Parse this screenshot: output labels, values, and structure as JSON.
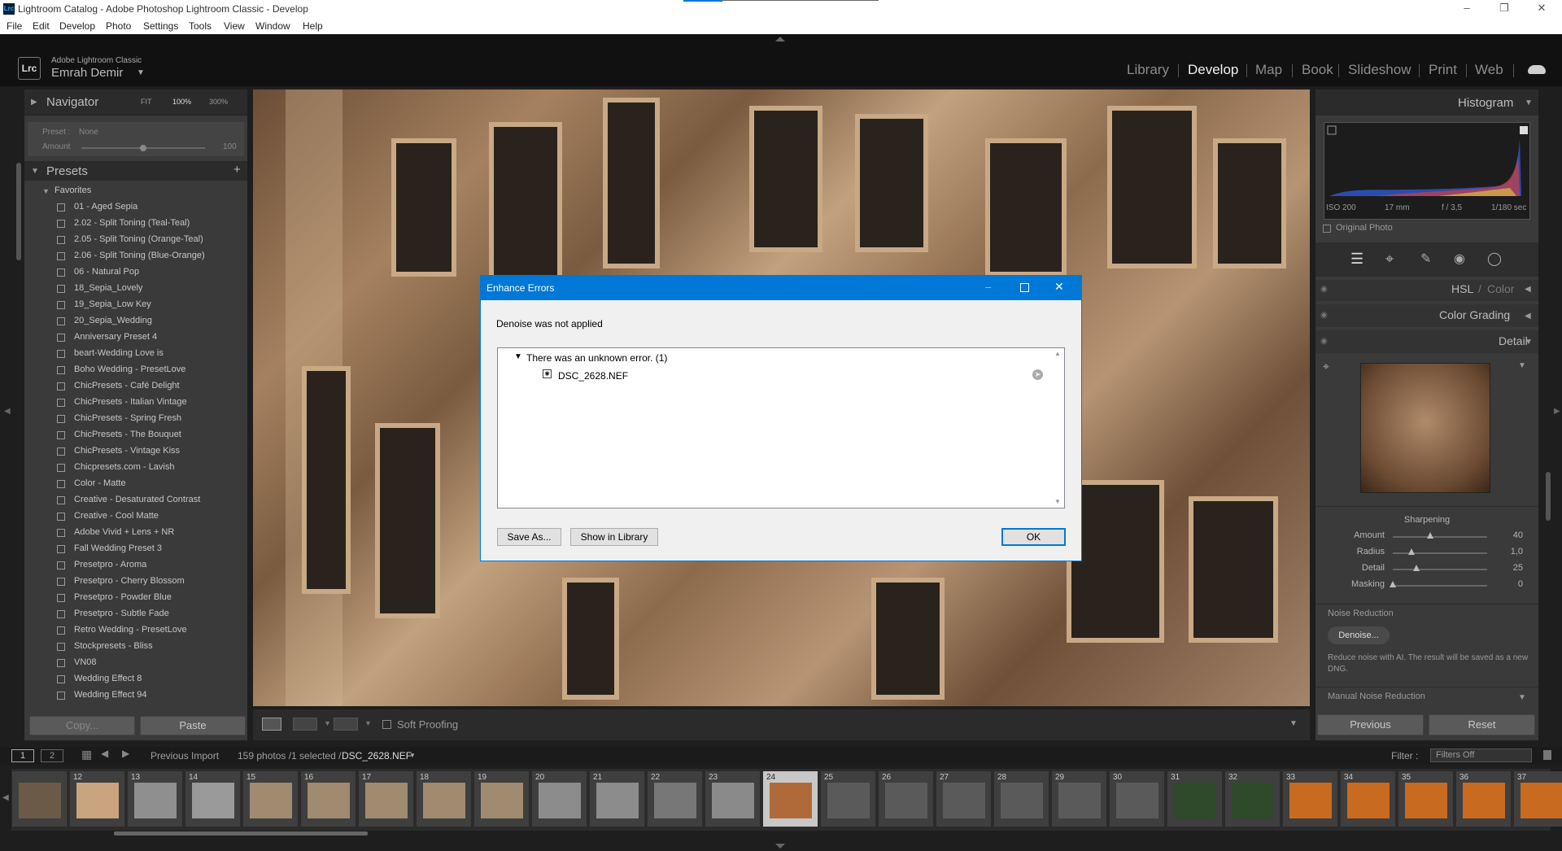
{
  "window": {
    "title": "Lightroom Catalog - Adobe Photoshop Lightroom Classic - Develop",
    "logo": "Lrc"
  },
  "menu": [
    "File",
    "Edit",
    "Develop",
    "Photo",
    "Settings",
    "Tools",
    "View",
    "Window",
    "Help"
  ],
  "identity": {
    "app": "Adobe Lightroom Classic",
    "user": "Emrah Demir"
  },
  "modules": [
    "Library",
    "Develop",
    "Map",
    "Book",
    "Slideshow",
    "Print",
    "Web"
  ],
  "active_module": "Develop",
  "navigator": {
    "title": "Navigator",
    "zoom_fit": "FIT",
    "zoom_100": "100%",
    "zoom_300": "300%"
  },
  "preset_amount": {
    "preset_label": "Preset :",
    "preset_value": "None",
    "amount_label": "Amount",
    "amount_value": "100"
  },
  "presets": {
    "title": "Presets",
    "folder": "Favorites",
    "items": [
      "01 - Aged Sepia",
      "2.02 - Split Toning (Teal-Teal)",
      "2.05 - Split Toning (Orange-Teal)",
      "2.06 - Split Toning (Blue-Orange)",
      "06 - Natural Pop",
      "18_Sepia_Lovely",
      "19_Sepia_Low Key",
      "20_Sepia_Wedding",
      "Anniversary Preset 4",
      "beart-Wedding Love is",
      "Boho Wedding - PresetLove",
      "ChicPresets - Café Delight",
      "ChicPresets - Italian Vintage",
      "ChicPresets - Spring Fresh",
      "ChicPresets - The Bouquet",
      "ChicPresets - Vintage Kiss",
      "Chicpresets.com - Lavish",
      "Color - Matte",
      "Creative - Desaturated Contrast",
      "Creative - Cool Matte",
      "Adobe Vivid + Lens + NR",
      "Fall Wedding Preset 3",
      "Presetpro - Aroma",
      "Presetpro - Cherry Blossom",
      "Presetpro - Powder Blue",
      "Presetpro - Subtle Fade",
      "Retro Wedding - PresetLove",
      "Stockpresets - Bliss",
      "VN08",
      "Wedding Effect 8",
      "Wedding Effect 94"
    ]
  },
  "left_buttons": {
    "copy": "Copy...",
    "paste": "Paste"
  },
  "toolbar": {
    "soft_proofing": "Soft Proofing"
  },
  "histogram": {
    "title": "Histogram",
    "iso": "ISO 200",
    "focal": "17 mm",
    "aperture": "f / 3,5",
    "shutter": "1/180 sec",
    "original_photo": "Original Photo"
  },
  "panels": {
    "hsl": "HSL",
    "color": "Color",
    "color_grading": "Color Grading",
    "detail": "Detail"
  },
  "sharpening": {
    "title": "Sharpening",
    "rows": [
      {
        "label": "Amount",
        "value": "40",
        "pos": 0.4
      },
      {
        "label": "Radius",
        "value": "1,0",
        "pos": 0.2
      },
      {
        "label": "Detail",
        "value": "25",
        "pos": 0.25
      },
      {
        "label": "Masking",
        "value": "0",
        "pos": 0.0
      }
    ]
  },
  "noise": {
    "title": "Noise Reduction",
    "denoise": "Denoise...",
    "desc": "Reduce noise with AI. The result will be saved as a new DNG.",
    "manual": "Manual Noise Reduction"
  },
  "right_buttons": {
    "previous": "Previous",
    "reset": "Reset"
  },
  "filmstrip_bar": {
    "screen1": "1",
    "screen2": "2",
    "source": "Previous Import",
    "count": "159 photos /1 selected /",
    "file": "DSC_2628.NEF",
    "filter_label": "Filter :",
    "filter_value": "Filters Off"
  },
  "filmstrip": [
    "",
    "12",
    "13",
    "14",
    "15",
    "16",
    "17",
    "18",
    "19",
    "20",
    "21",
    "22",
    "23",
    "24",
    "25",
    "26",
    "27",
    "28",
    "29",
    "30",
    "31",
    "32",
    "33",
    "34",
    "35",
    "36",
    "37"
  ],
  "selected_frame": "24",
  "dialog": {
    "title": "Enhance Errors",
    "message": "Denoise was not applied",
    "error_group": "There was an unknown error. (1)",
    "file": "DSC_2628.NEF",
    "save_as": "Save As...",
    "show_in_library": "Show in Library",
    "ok": "OK"
  },
  "colors": {
    "accent": "#0078d7",
    "panel": "#3a3a3a",
    "background": "#1e1e1e",
    "selected_frame": "#c8c8c8"
  }
}
